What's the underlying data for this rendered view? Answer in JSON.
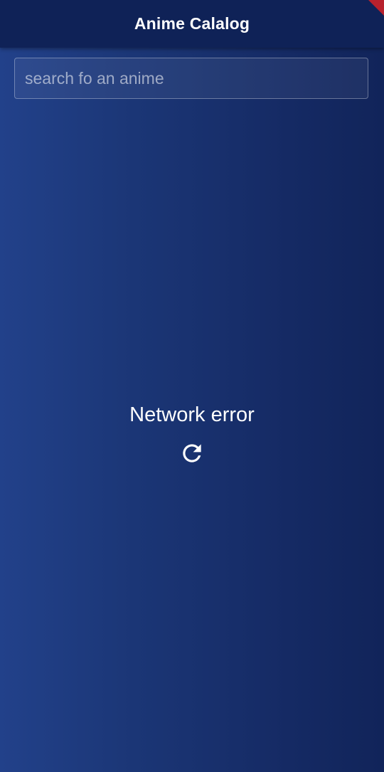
{
  "app_bar": {
    "title": "Anime Calalog"
  },
  "search": {
    "placeholder": "search fo an anime",
    "value": ""
  },
  "status": {
    "message": "Network error",
    "retry_icon": "refresh-icon"
  },
  "colors": {
    "app_bar": "#0f2257",
    "background_left": "#22418a",
    "background_right": "#11245a",
    "debug_banner": "#b8212d",
    "text": "#ffffff"
  }
}
